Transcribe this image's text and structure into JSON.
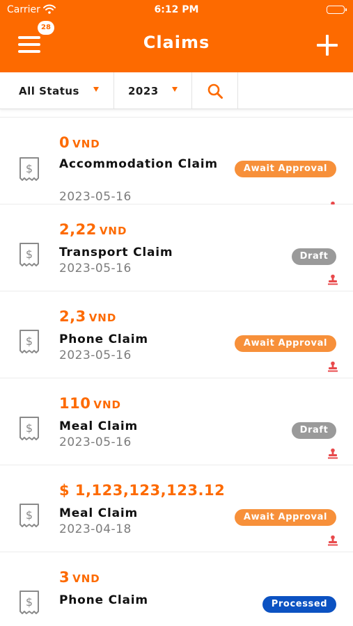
{
  "status_bar": {
    "carrier": "Carrier",
    "time": "6:12 PM"
  },
  "header": {
    "title": "Claims",
    "notification_count": "28",
    "menu_icon": "hamburger-menu-icon",
    "add_icon": "plus-icon",
    "background_color": "#fd6a00"
  },
  "filters": {
    "status_value": "All Status",
    "year_value": "2023",
    "search_icon": "search-icon"
  },
  "claims": [
    {
      "amount": "0",
      "currency": "VND",
      "name": "Accommodation Claim",
      "date": "2023-05-16",
      "status": "Await Approval"
    },
    {
      "amount": "2,22",
      "currency": "VND",
      "name": "Transport Claim",
      "date": "2023-05-16",
      "status": "Draft"
    },
    {
      "amount": "2,3",
      "currency": "VND",
      "name": "Phone Claim",
      "date": "2023-05-16",
      "status": "Await Approval"
    },
    {
      "amount": "110",
      "currency": "VND",
      "name": "Meal Claim",
      "date": "2023-05-16",
      "status": "Draft"
    },
    {
      "amount": "$ 1,123,123,123.12",
      "currency": "",
      "name": "Meal Claim",
      "date": "2023-04-18",
      "status": "Await Approval"
    },
    {
      "amount": "3",
      "currency": "VND",
      "name": "Phone Claim",
      "date": "",
      "status": "Processed"
    }
  ],
  "colors": {
    "accent": "#fd6a00",
    "await_approval": "#f7903a",
    "draft": "#9a9a9a",
    "processed": "#0c52c2",
    "stamp": "#e8494b"
  }
}
